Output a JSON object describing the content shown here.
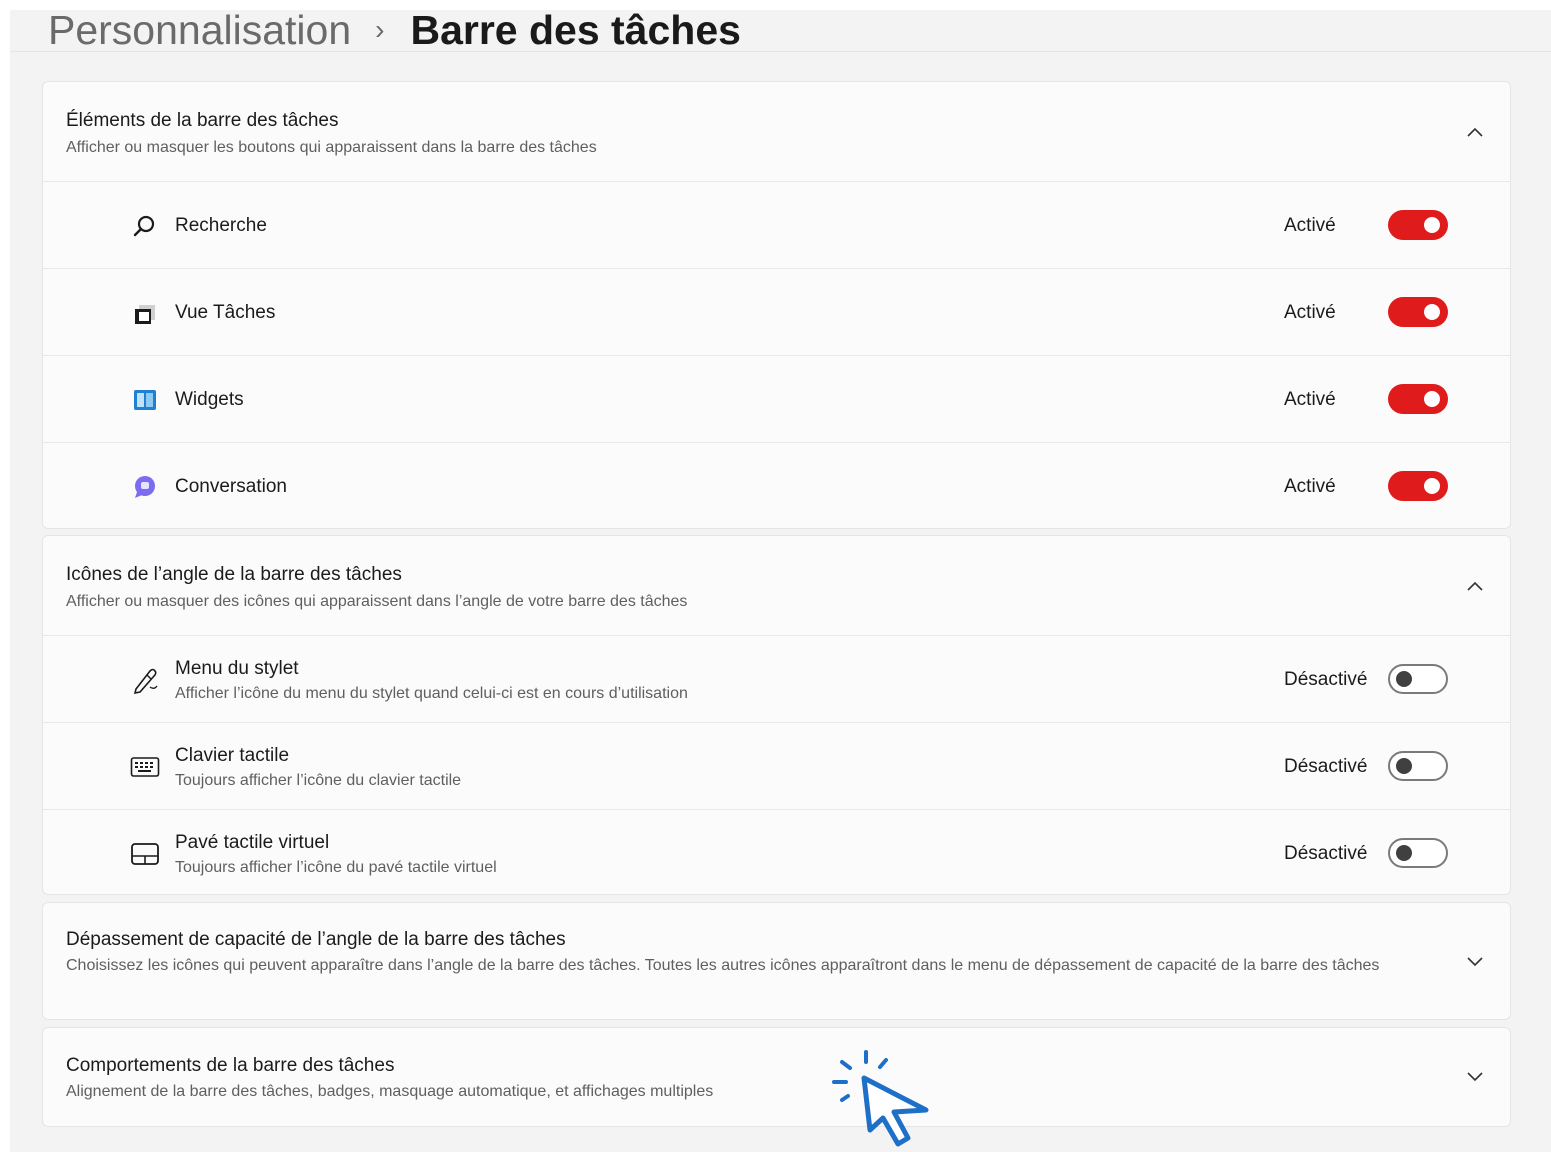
{
  "breadcrumb": {
    "parent": "Personnalisation",
    "separator": "›",
    "current": "Barre des tâches"
  },
  "sections": {
    "taskbar_items": {
      "title": "Éléments de la barre des tâches",
      "subtitle": "Afficher ou masquer les boutons qui apparaissent dans la barre des tâches",
      "expanded": true,
      "items": [
        {
          "label": "Recherche",
          "state": "Activé",
          "on": true,
          "icon": "search-icon"
        },
        {
          "label": "Vue Tâches",
          "state": "Activé",
          "on": true,
          "icon": "task-view-icon"
        },
        {
          "label": "Widgets",
          "state": "Activé",
          "on": true,
          "icon": "widgets-icon"
        },
        {
          "label": "Conversation",
          "state": "Activé",
          "on": true,
          "icon": "chat-icon"
        }
      ]
    },
    "corner_icons": {
      "title": "Icônes de l’angle de la barre des tâches",
      "subtitle": "Afficher ou masquer des icônes qui apparaissent dans l’angle de votre barre des tâches",
      "expanded": true,
      "items": [
        {
          "label": "Menu du stylet",
          "description": "Afficher l’icône du menu du stylet quand celui-ci est en cours d’utilisation",
          "state": "Désactivé",
          "on": false,
          "icon": "pen-icon"
        },
        {
          "label": "Clavier tactile",
          "description": "Toujours afficher l’icône du clavier tactile",
          "state": "Désactivé",
          "on": false,
          "icon": "keyboard-icon"
        },
        {
          "label": "Pavé tactile virtuel",
          "description": "Toujours afficher l’icône du pavé tactile virtuel",
          "state": "Désactivé",
          "on": false,
          "icon": "touchpad-icon"
        }
      ]
    },
    "corner_overflow": {
      "title": "Dépassement de capacité de l’angle de la barre des tâches",
      "subtitle": "Choisissez les icônes qui peuvent apparaître dans l’angle de la barre des tâches. Toutes les autres icônes apparaîtront dans le menu de dépassement de capacité de la barre des tâches",
      "expanded": false
    },
    "behaviors": {
      "title": "Comportements de la barre des tâches",
      "subtitle": "Alignement de la barre des tâches, badges, masquage automatique, et affichages multiples",
      "expanded": false
    }
  },
  "colors": {
    "toggle_on": "#e01b1b",
    "cursor_accent": "#1e6fc7"
  }
}
